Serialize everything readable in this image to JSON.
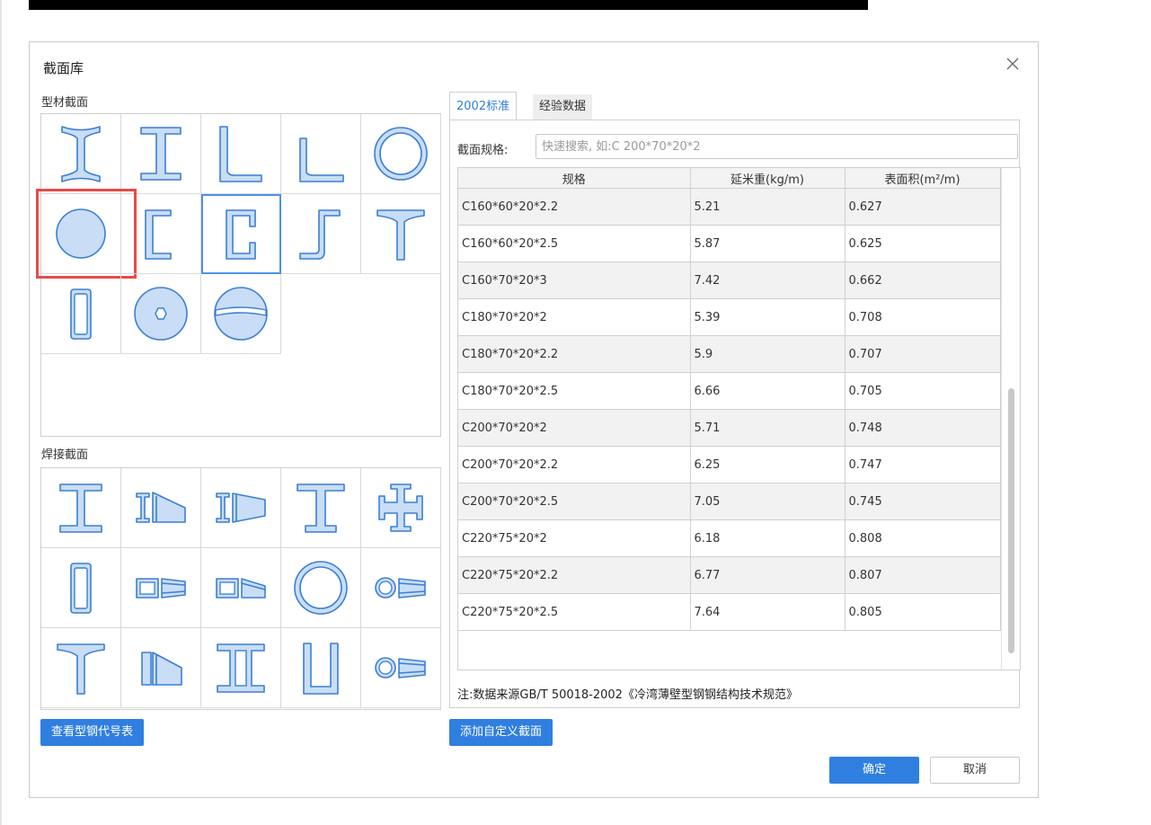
{
  "dialog": {
    "title": "截面库",
    "section_profiles_label": "型材截面",
    "section_welded_label": "焊接截面",
    "view_code_button": "查看型钢代号表",
    "add_custom_button": "添加自定义截面",
    "ok_button": "确定",
    "cancel_button": "取消"
  },
  "tabs": [
    {
      "label": "2002标准",
      "active": true
    },
    {
      "label": "经验数据",
      "active": false
    }
  ],
  "search": {
    "label": "截面规格:",
    "placeholder": "快速搜索, 如:C 200*70*20*2",
    "value": ""
  },
  "table": {
    "headers": [
      "规格",
      "延米重(kg/m)",
      "表面积(m²/m)"
    ],
    "rows": [
      [
        "C160*60*20*2.2",
        "5.21",
        "0.627"
      ],
      [
        "C160*60*20*2.5",
        "5.87",
        "0.625"
      ],
      [
        "C160*70*20*3",
        "7.42",
        "0.662"
      ],
      [
        "C180*70*20*2",
        "5.39",
        "0.708"
      ],
      [
        "C180*70*20*2.2",
        "5.9",
        "0.707"
      ],
      [
        "C180*70*20*2.5",
        "6.66",
        "0.705"
      ],
      [
        "C200*70*20*2",
        "5.71",
        "0.748"
      ],
      [
        "C200*70*20*2.2",
        "6.25",
        "0.747"
      ],
      [
        "C200*70*20*2.5",
        "7.05",
        "0.745"
      ],
      [
        "C220*75*20*2",
        "6.18",
        "0.808"
      ],
      [
        "C220*75*20*2.2",
        "6.77",
        "0.807"
      ],
      [
        "C220*75*20*2.5",
        "7.64",
        "0.805"
      ]
    ]
  },
  "note": "注:数据来源GB/T 50018-2002《冷湾薄壁型钢钢结构技术规范》",
  "profile_shapes": [
    "i-beam-icon",
    "h-section-icon",
    "equal-angle-icon",
    "unequal-angle-icon",
    "circular-tube-icon",
    "solid-round-icon",
    "channel-open-icon",
    "c-channel-lipped-icon",
    "z-section-icon",
    "t-section-icon",
    "rectangular-tube-icon",
    "hollow-disk-icon",
    "split-circle-icon"
  ],
  "welded_shapes": [
    "welded-i-icon",
    "welded-i-tapered-icon",
    "welded-i-tapered-flange-icon",
    "welded-t-wide-icon",
    "welded-cross-icon",
    "welded-box-icon",
    "welded-box-tapered-icon",
    "welded-box-tapered-2-icon",
    "welded-circular-tube-icon",
    "welded-tube-tapered-icon",
    "welded-t-icon",
    "welded-t-tapered-icon",
    "welded-double-i-icon",
    "welded-u-icon",
    "welded-tube-tapered-2-icon"
  ],
  "selected_profile_index": 7,
  "highlighted_profile_index": 5,
  "colors": {
    "accent": "#2f7fe0",
    "shape_fill": "#c9ddf7",
    "shape_stroke": "#3a7fd4",
    "highlight": "#e84a4a"
  }
}
